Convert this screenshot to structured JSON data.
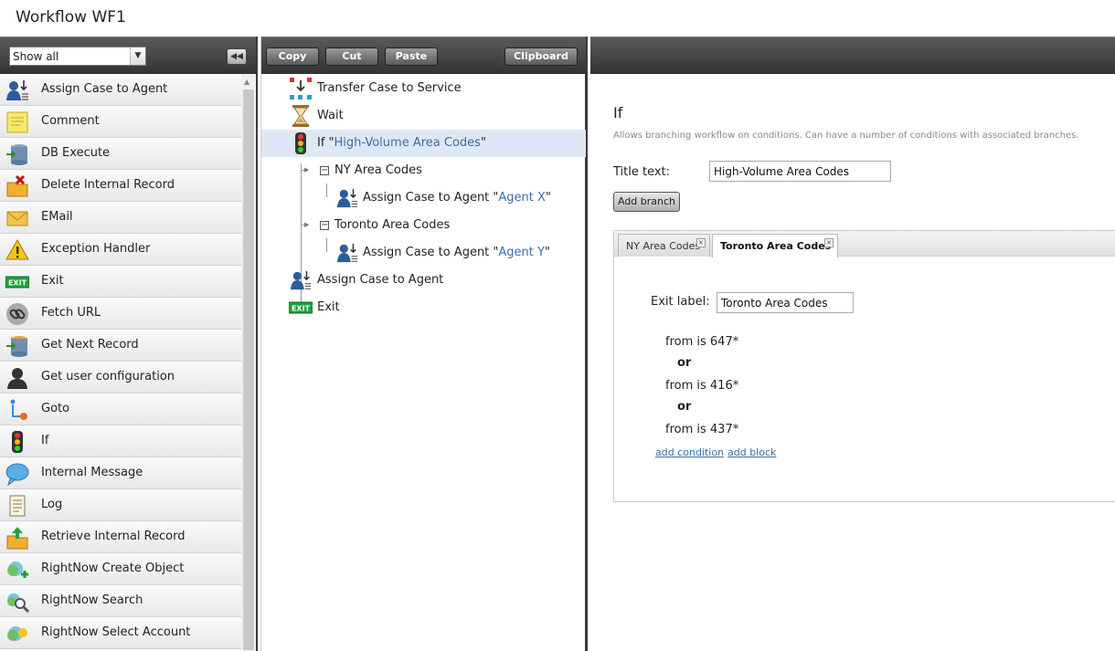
{
  "window": {
    "title": "Workflow WF1"
  },
  "palette": {
    "filter_value": "Show all",
    "items": [
      {
        "label": "Assign Case to Agent",
        "icon": "assign-agent"
      },
      {
        "label": "Comment",
        "icon": "comment"
      },
      {
        "label": "DB Execute",
        "icon": "db-execute"
      },
      {
        "label": "Delete Internal Record",
        "icon": "delete-record"
      },
      {
        "label": "EMail",
        "icon": "email"
      },
      {
        "label": "Exception Handler",
        "icon": "warning"
      },
      {
        "label": "Exit",
        "icon": "exit"
      },
      {
        "label": "Fetch URL",
        "icon": "link"
      },
      {
        "label": "Get Next Record",
        "icon": "db-next"
      },
      {
        "label": "Get user configuration",
        "icon": "user"
      },
      {
        "label": "Goto",
        "icon": "goto"
      },
      {
        "label": "If",
        "icon": "traffic-light"
      },
      {
        "label": "Internal Message",
        "icon": "speech-bubble"
      },
      {
        "label": "Log",
        "icon": "log"
      },
      {
        "label": "Retrieve Internal Record",
        "icon": "retrieve-record"
      },
      {
        "label": "RightNow Create Object",
        "icon": "rightnow-create"
      },
      {
        "label": "RightNow Search",
        "icon": "rightnow-search"
      },
      {
        "label": "RightNow Select Account",
        "icon": "rightnow-select"
      }
    ]
  },
  "toolbar": {
    "copy": "Copy",
    "cut": "Cut",
    "paste": "Paste",
    "clipboard": "Clipboard",
    "exit_badge": "EXIT"
  },
  "tree": {
    "transfer": "Transfer Case to Service",
    "wait": "Wait",
    "if_prefix": "If \"",
    "if_name": "High-Volume Area Codes",
    "close_quote": "\"",
    "branch1": "NY Area Codes",
    "assign_prefix": "Assign Case to Agent \"",
    "agent_x": "Agent X",
    "branch2": "Toronto Area Codes",
    "agent_y": "Agent Y",
    "assign": "Assign Case to Agent",
    "exit": "Exit"
  },
  "props": {
    "heading": "If",
    "description": "Allows branching workflow on conditions. Can have a number of conditions with associated branches.",
    "title_label": "Title text:",
    "title_value": "High-Volume Area Codes",
    "add_branch": "Add branch",
    "tabs": [
      "NY Area Codes",
      "Toronto Area Codes"
    ],
    "exit_label": "Exit label:",
    "exit_value": "Toronto Area Codes",
    "conditions": [
      "from is 647*",
      "from is 416*",
      "from is 437*"
    ],
    "or": "or",
    "add_condition": "add condition",
    "add_block": "add block"
  }
}
